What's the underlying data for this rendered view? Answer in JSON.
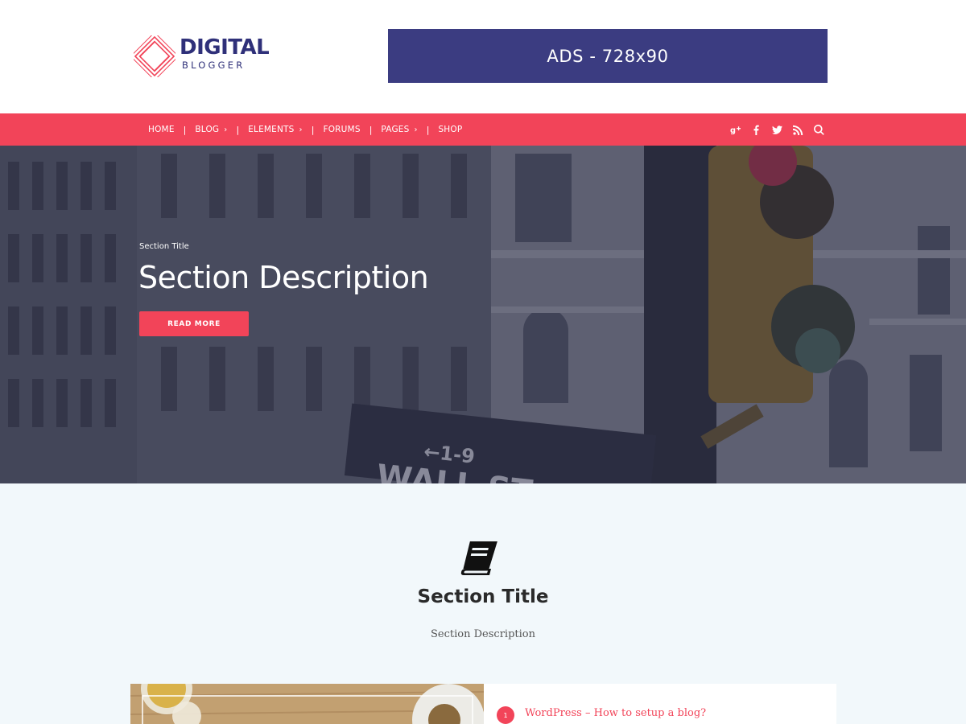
{
  "header": {
    "logo": {
      "word1": "DIGITAL",
      "word2": "BLOGGER",
      "brand_color": "#2f3079",
      "mark_color": "#f24459"
    },
    "ad_label": "ADS - 728x90",
    "ad_color": "#3b3c81"
  },
  "nav": {
    "background": "#f24459",
    "items": [
      {
        "label": "HOME",
        "has_submenu": false
      },
      {
        "label": "BLOG",
        "has_submenu": true
      },
      {
        "label": "ELEMENTS",
        "has_submenu": true
      },
      {
        "label": "FORUMS",
        "has_submenu": false
      },
      {
        "label": "PAGES",
        "has_submenu": true
      },
      {
        "label": "SHOP",
        "has_submenu": false
      }
    ],
    "separator": "|",
    "social_icons": [
      "google-plus-icon",
      "facebook-icon",
      "twitter-icon",
      "rss-icon",
      "search-icon"
    ]
  },
  "hero": {
    "kicker": "Section Title",
    "title": "Section Description",
    "button_label": "READ MORE",
    "sign_text": "←1-9",
    "sign_text2": "WALL ST"
  },
  "section": {
    "icon": "book-icon",
    "title": "Section Title",
    "description": "Section Description",
    "list": [
      {
        "number": "1",
        "title": "WordPress – How to setup a blog?"
      }
    ]
  }
}
